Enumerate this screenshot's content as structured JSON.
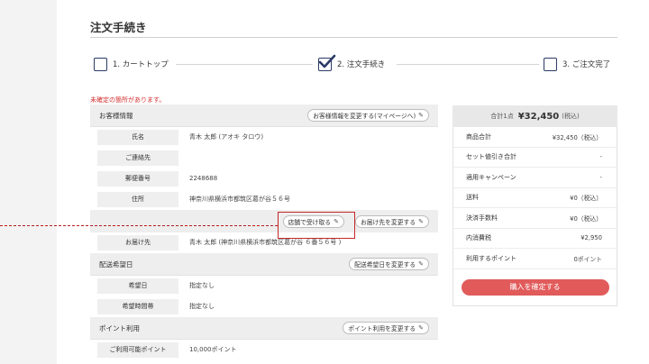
{
  "page": {
    "title": "注文手続き",
    "warning": "未確定の箇所があります。"
  },
  "steps": [
    {
      "label": "1. カートトップ",
      "checked": false
    },
    {
      "label": "2. 注文手続き",
      "checked": true
    },
    {
      "label": "3. ご注文完了",
      "checked": false
    }
  ],
  "customer": {
    "section_title": "お客様情報",
    "change_button": "お客様情報を変更する(マイページへ)",
    "rows": [
      {
        "label": "氏名",
        "value": "青木 太郎 (アオキ タロウ)"
      },
      {
        "label": "ご連絡先",
        "value": ""
      },
      {
        "label": "郵便番号",
        "value": "2248688"
      },
      {
        "label": "住所",
        "value": "神奈川県横浜市都筑区葛が谷５６号"
      }
    ]
  },
  "delivery": {
    "store_pickup_button": "店舗で受け取る",
    "change_destination_button": "お届け先を変更する",
    "destination_label": "お届け先",
    "destination_value": "青木 太郎 (神奈川県横浜市都筑区葛が谷 ６番５６号 )"
  },
  "delivery_date": {
    "section_title": "配送希望日",
    "change_button": "配送希望日を変更する",
    "rows": [
      {
        "label": "希望日",
        "value": "指定なし"
      },
      {
        "label": "希望時間帯",
        "value": "指定なし"
      }
    ]
  },
  "points": {
    "section_title": "ポイント利用",
    "change_button": "ポイント利用を変更する",
    "rows": [
      {
        "label": "ご利用可能ポイント",
        "value": "10,000ポイント"
      }
    ]
  },
  "summary": {
    "count_text": "合計1点",
    "total": "¥32,450",
    "tax_text": "(税込)",
    "rows": [
      {
        "label": "商品合計",
        "value": "¥32,450（税込）"
      },
      {
        "label": "セット値引き合計",
        "value": "-"
      },
      {
        "label": "適用キャンペーン",
        "value": "-"
      },
      {
        "label": "送料",
        "value": "¥0（税込）"
      },
      {
        "label": "決済手数料",
        "value": "¥0（税込）"
      },
      {
        "label": "内消費税",
        "value": "¥2,950"
      },
      {
        "label": "利用するポイント",
        "value": "0ポイント"
      }
    ],
    "confirm_button": "購入を確定する"
  },
  "colors": {
    "accent_red": "#e15b5b",
    "highlight": "#c62828",
    "check_navy": "#2b3a66"
  },
  "icons": {
    "edit": "edit-icon",
    "check": "check-icon"
  }
}
